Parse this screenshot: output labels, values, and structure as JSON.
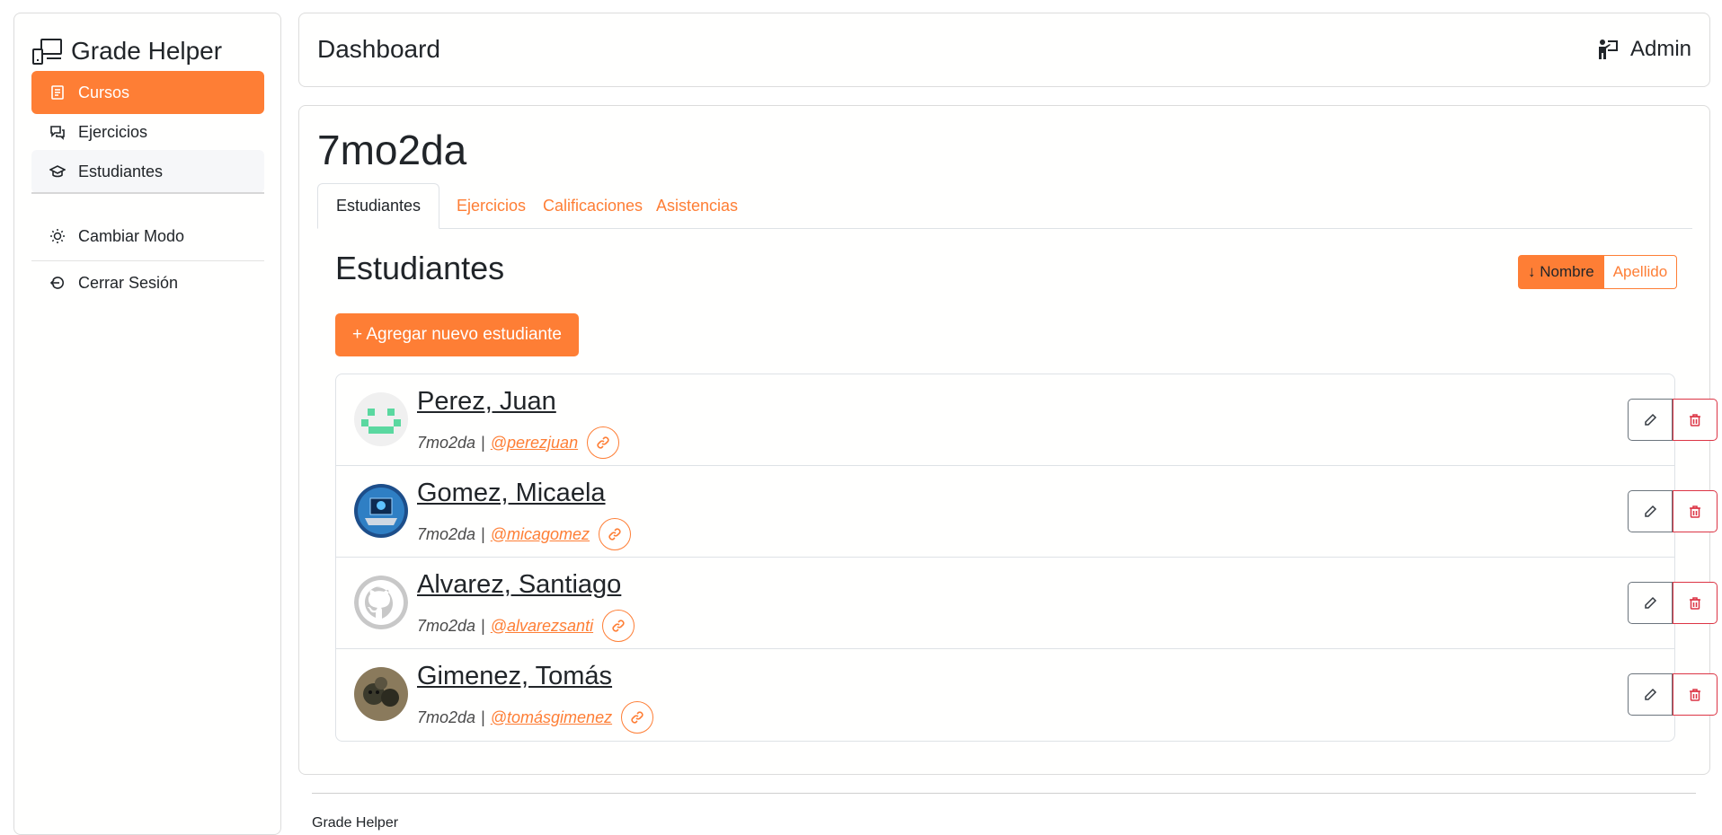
{
  "app": {
    "name": "Grade Helper"
  },
  "sidebar": {
    "items": [
      {
        "label": "Cursos",
        "icon": "document-icon",
        "active": true
      },
      {
        "label": "Ejercicios",
        "icon": "chat-icon"
      },
      {
        "label": "Estudiantes",
        "icon": "graduation-cap-icon"
      }
    ],
    "secondary": [
      {
        "label": "Cambiar Modo",
        "icon": "sun-icon"
      },
      {
        "label": "Cerrar Sesión",
        "icon": "logout-icon"
      }
    ]
  },
  "header": {
    "title": "Dashboard",
    "user": "Admin",
    "user_icon": "teacher-icon"
  },
  "course": {
    "title": "7mo2da",
    "tabs": [
      {
        "label": "Estudiantes",
        "active": true
      },
      {
        "label": "Ejercicios"
      },
      {
        "label": "Calificaciones"
      },
      {
        "label": "Asistencias"
      }
    ]
  },
  "students_section": {
    "title": "Estudiantes",
    "sort": {
      "primary": "↓ Nombre",
      "secondary": "Apellido"
    },
    "add_label": "+ Agregar nuevo estudiante",
    "students": [
      {
        "name": "Perez, Juan",
        "course": "7mo2da",
        "handle": "@perezjuan"
      },
      {
        "name": "Gomez, Micaela",
        "course": "7mo2da",
        "handle": "@micagomez"
      },
      {
        "name": "Alvarez, Santiago",
        "course": "7mo2da",
        "handle": "@alvarezsanti"
      },
      {
        "name": "Gimenez, Tomás",
        "course": "7mo2da",
        "handle": "@tomásgimenez"
      }
    ]
  },
  "footer": {
    "text": "Grade Helper"
  },
  "colors": {
    "accent": "#fe7e35",
    "danger": "#dc3545",
    "secondary": "#6c757d"
  }
}
